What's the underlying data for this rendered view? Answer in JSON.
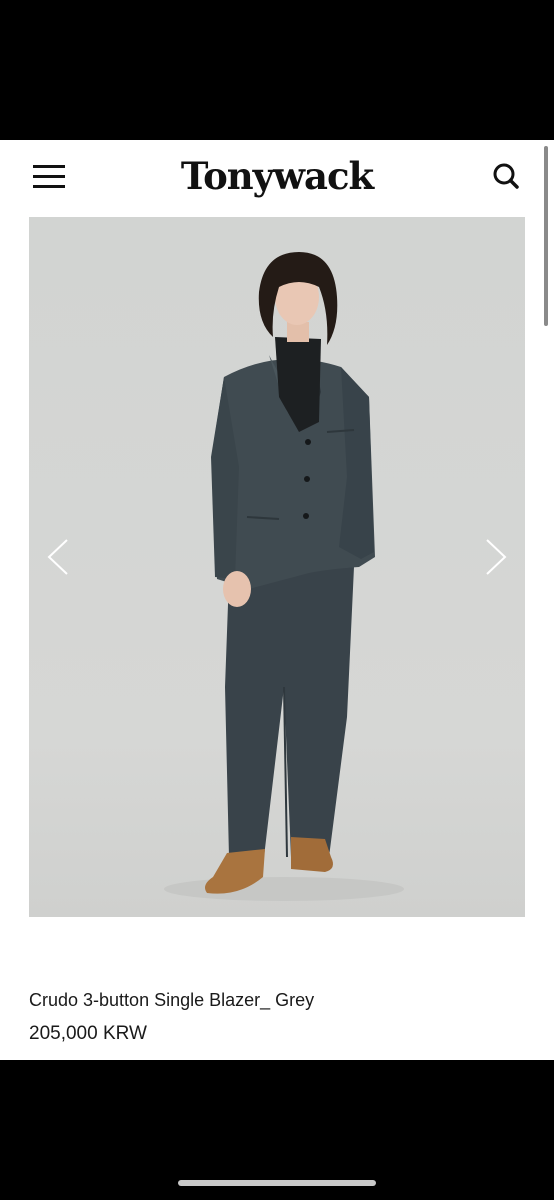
{
  "header": {
    "brand": "Tonywack",
    "menu_icon": "hamburger-menu-icon",
    "search_icon": "search-icon"
  },
  "gallery": {
    "prev_icon": "chevron-left-icon",
    "next_icon": "chevron-right-icon",
    "image_subject": "model in grey three-button single blazer and trousers",
    "background_color": "#d3d4d2",
    "suit_color": "#3c464a"
  },
  "product": {
    "name": "Crudo 3-button Single Blazer_ Grey",
    "price": "205,000 KRW"
  }
}
